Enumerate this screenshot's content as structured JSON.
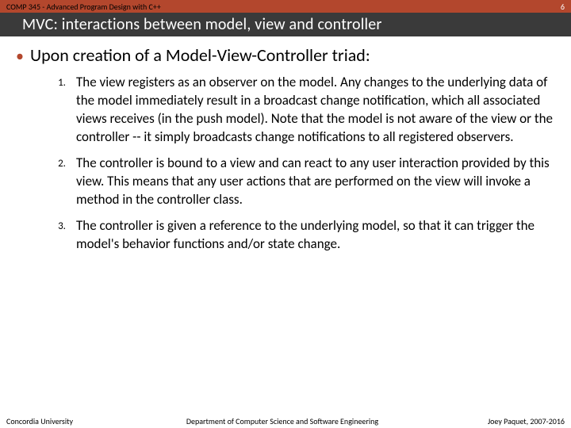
{
  "header": {
    "course": "COMP 345 - Advanced Program Design with C++",
    "page": "6",
    "title": "MVC: interactions between model, view and controller"
  },
  "body": {
    "lead_bullet": "Upon creation of a Model-View-Controller triad:",
    "items": [
      {
        "num": "1.",
        "text": "The view registers as an observer on the model. Any changes to the underlying data of the model immediately result in a broadcast change notification, which all associated views receives (in the push model). Note that the model is not aware of the view or the controller -- it simply broadcasts change notifications to all registered observers."
      },
      {
        "num": "2.",
        "text": "The controller is bound to a view and can react to any user interaction provided by this view. This means that any user actions that are performed on the view will invoke a method in the controller class."
      },
      {
        "num": "3.",
        "text": "The controller is given a reference to the underlying model, so that it can trigger the model's behavior functions and/or state change."
      }
    ]
  },
  "footer": {
    "left": "Concordia University",
    "center": "Department of Computer Science and Software Engineering",
    "right": "Joey Paquet, 2007-2016"
  }
}
